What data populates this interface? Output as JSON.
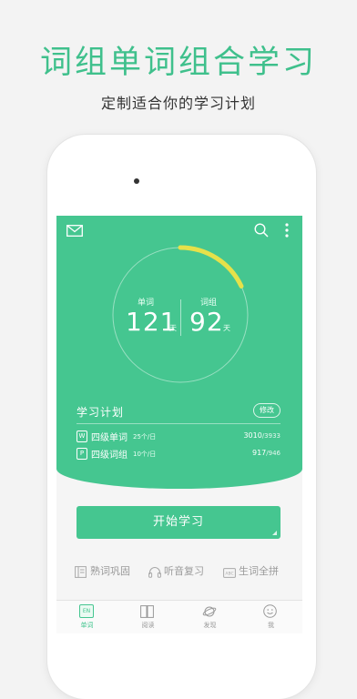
{
  "promo": {
    "headline": "词组单词组合学习",
    "subline": "定制适合你的学习计划"
  },
  "topbar": {
    "icons": [
      "mail-icon",
      "search-icon",
      "more-vertical-icon"
    ]
  },
  "stats": {
    "progress_fraction": 0.18,
    "words": {
      "label": "单词",
      "value": "121",
      "unit": "天"
    },
    "phrases": {
      "label": "词组",
      "value": "92",
      "unit": "天"
    }
  },
  "plan": {
    "title": "学习计划",
    "edit_label": "修改",
    "items": [
      {
        "badge": "W",
        "name": "四级单词",
        "rate": "25个/日",
        "done": "3010",
        "total": "/3933"
      },
      {
        "badge": "P",
        "name": "四级词组",
        "rate": "10个/日",
        "done": "917",
        "total": "/946"
      }
    ]
  },
  "start_button": {
    "label": "开始学习"
  },
  "tools": [
    {
      "label": "熟词巩固",
      "icon": "book-icon"
    },
    {
      "label": "听音复习",
      "icon": "headphones-icon"
    },
    {
      "label": "生词全拼",
      "icon": "keyboard-icon"
    }
  ],
  "tabs": [
    {
      "label": "单词",
      "icon_text": "EN",
      "active": true
    },
    {
      "label": "阅读",
      "icon": "open-book-icon"
    },
    {
      "label": "发现",
      "icon": "planet-icon"
    },
    {
      "label": "我",
      "icon": "smiley-icon"
    }
  ],
  "colors": {
    "accent": "#45c690",
    "progress": "#e6e14a",
    "headline": "#3fc08c"
  }
}
